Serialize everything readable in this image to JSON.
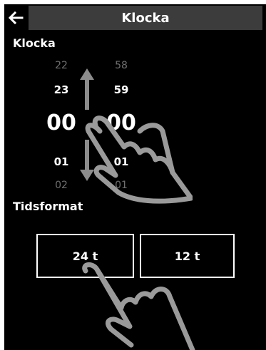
{
  "header": {
    "back_icon": "back-arrow-icon",
    "title": "Klocka"
  },
  "clock_section": {
    "label": "Klocka",
    "hours": {
      "prev2": "22",
      "prev1": "23",
      "selected": "00",
      "next1": "01",
      "next2": "02"
    },
    "minutes": {
      "prev2": "58",
      "prev1": "59",
      "selected": "00",
      "next1": "01",
      "next2": "01"
    }
  },
  "time_format_section": {
    "label": "Tidsformat",
    "options": [
      "24 t",
      "12 t"
    ]
  },
  "overlay": {
    "icon": "pointing-hand-icon"
  },
  "colors": {
    "background": "#000000",
    "title_bar": "#3c3c3c",
    "text": "#ffffff",
    "dim_text": "#6f6f6f",
    "hand": "#9a9a9a"
  }
}
